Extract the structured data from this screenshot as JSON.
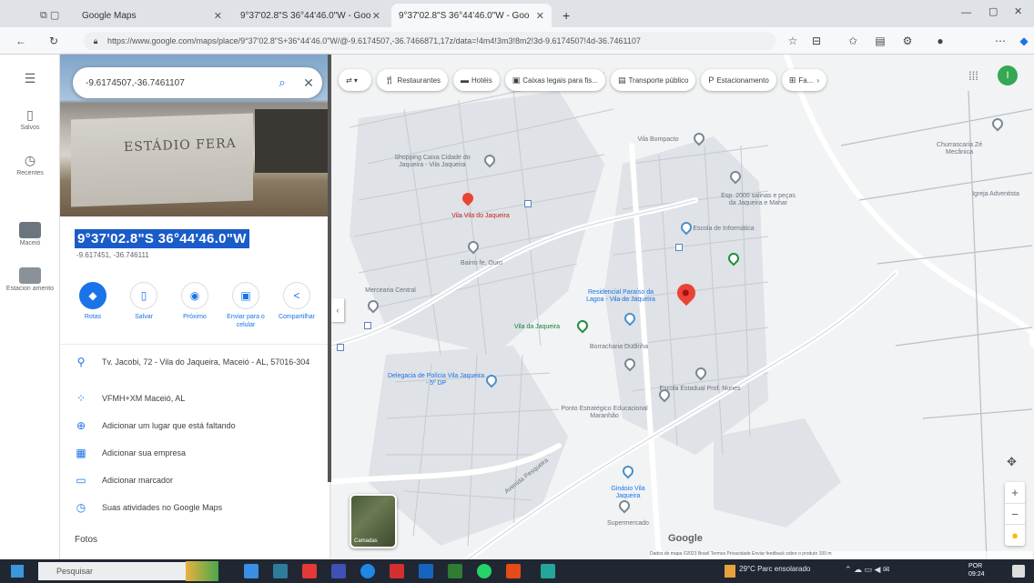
{
  "browser": {
    "tabs": [
      {
        "label": "Google Maps"
      },
      {
        "label": "9°37'02.8\"S 36°44'46.0\"W - Goo"
      },
      {
        "label": "9°37'02.8\"S 36°44'46.0\"W - Goo"
      }
    ],
    "url": "https://www.google.com/maps/place/9°37'02.8\"S+36°44'46.0\"W/@-9.6174507,-36.7466871,17z/data=!4m4!3m3!8m2!3d-9.6174507!4d-36.7461107"
  },
  "rail": {
    "items": [
      {
        "label": "Menu",
        "icon": "menu-icon"
      },
      {
        "label": "Salvos",
        "icon": "bookmark-icon"
      },
      {
        "label": "Recentes",
        "icon": "history-icon"
      },
      {
        "label": "Maceió",
        "icon": "city-icon"
      },
      {
        "label": "Estacion amento",
        "icon": "parking-icon"
      }
    ]
  },
  "panel": {
    "search_value": "-9.6174507,-36.7461107",
    "photo_text": "ESTÁDIO FERA",
    "coords": "9°37'02.8\"S 36°44'46.0\"W",
    "subcoords": "-9.617451, -36.746111",
    "actions": [
      {
        "label": "Rotas",
        "icon": "directions-icon"
      },
      {
        "label": "Salvar",
        "icon": "save-icon"
      },
      {
        "label": "Próximo",
        "icon": "nearby-icon"
      },
      {
        "label": "Enviar para o celular",
        "icon": "phone-icon"
      },
      {
        "label": "Compartilhar",
        "icon": "share-icon"
      }
    ],
    "info": [
      {
        "text": "Tv. Jacobi, 72 - Vila do Jaqueira, Maceió - AL, 57016-304",
        "icon": "pin-icon"
      },
      {
        "text": "VFMH+XM Maceió, AL",
        "icon": "plus-code-icon"
      },
      {
        "text": "Adicionar um lugar que está faltando",
        "icon": "add-place-icon"
      },
      {
        "text": "Adicionar sua empresa",
        "icon": "business-icon"
      },
      {
        "text": "Adicionar marcador",
        "icon": "label-icon"
      },
      {
        "text": "Suas atividades no Google Maps",
        "icon": "history-icon"
      }
    ],
    "fotos_label": "Fotos"
  },
  "map": {
    "chips": [
      {
        "label": "Restaurantes",
        "icon": "restaurant-icon"
      },
      {
        "label": "Hotéis",
        "icon": "hotel-icon"
      },
      {
        "label": "Caixas legais para fis...",
        "icon": "atm-icon"
      },
      {
        "label": "Transporte público",
        "icon": "transit-icon"
      },
      {
        "label": "Estacionamento",
        "icon": "parking-icon"
      },
      {
        "label": "Fa...",
        "icon": "pharmacy-icon"
      }
    ],
    "places": [
      {
        "label": "Shopping Caixa Cidade do Jaqueira - Vila Jaqueira"
      },
      {
        "label": "Vila Vila do Jaqueira"
      },
      {
        "label": "Bairro fe, Ouro"
      },
      {
        "label": "Vila Bompacto"
      },
      {
        "label": "Esp. 2000 salinas e peças da Jaqueira e Mahar"
      },
      {
        "label": "Escola de Informática"
      },
      {
        "label": "Vila da Jaqueira"
      },
      {
        "label": "Residencial Paraíso da Lagoa - Vila da Jaqueira"
      },
      {
        "label": "Borracharia Dudinha"
      },
      {
        "label": "Delegacia de Polícia Vila Jaqueira - 5º DP"
      },
      {
        "label": "Escola Estadual Prof. Nunes"
      },
      {
        "label": "Ponto Estratégico Educacional Maranhão"
      },
      {
        "label": "Mercearia Central"
      },
      {
        "label": "Ginásio Vila Jaqueira"
      },
      {
        "label": "Supermercado"
      },
      {
        "label": "Churrascaria Zé Mecânica"
      },
      {
        "label": "Igreja Adventista"
      },
      {
        "label": "Avenida Pesqueira"
      }
    ],
    "layers_label": "Camadas",
    "google_label": "Google",
    "attribution": "Dados do mapa ©2023   Brasil   Termos   Privacidade   Enviar feedback sobre o produto   100 m",
    "zoom_in": "+",
    "zoom_out": "−",
    "avatar_letter": "I"
  },
  "taskbar": {
    "search_placeholder": "Pesquisar",
    "tray_text": "29°C Parc ensolarado",
    "clock_time": "09:24",
    "clock_lang": "POR"
  }
}
